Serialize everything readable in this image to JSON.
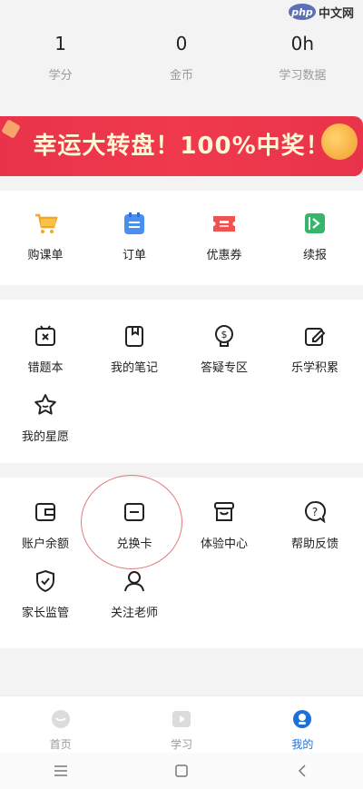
{
  "watermark": {
    "logo": "php",
    "text": "中文网"
  },
  "stats": [
    {
      "value": "1",
      "label": "学分"
    },
    {
      "value": "0",
      "label": "金币"
    },
    {
      "value": "0h",
      "label": "学习数据"
    }
  ],
  "banner": {
    "text": "幸运大转盘！100%中奖！"
  },
  "section1": [
    {
      "label": "购课单",
      "icon": "shopping-cart-icon"
    },
    {
      "label": "订单",
      "icon": "order-icon"
    },
    {
      "label": "优惠券",
      "icon": "coupon-icon"
    },
    {
      "label": "续报",
      "icon": "renew-icon"
    }
  ],
  "section2": [
    {
      "label": "错题本",
      "icon": "wrong-book-icon"
    },
    {
      "label": "我的笔记",
      "icon": "notes-icon"
    },
    {
      "label": "答疑专区",
      "icon": "qa-icon"
    },
    {
      "label": "乐学积累",
      "icon": "accumulate-icon"
    },
    {
      "label": "我的星愿",
      "icon": "star-wish-icon"
    }
  ],
  "section3": [
    {
      "label": "账户余额",
      "icon": "wallet-icon"
    },
    {
      "label": "兑换卡",
      "icon": "card-icon"
    },
    {
      "label": "体验中心",
      "icon": "experience-icon"
    },
    {
      "label": "帮助反馈",
      "icon": "help-icon"
    },
    {
      "label": "家长监管",
      "icon": "shield-icon"
    },
    {
      "label": "关注老师",
      "icon": "person-icon"
    }
  ],
  "tabs": [
    {
      "label": "首页",
      "icon": "home-icon"
    },
    {
      "label": "学习",
      "icon": "play-icon"
    },
    {
      "label": "我的",
      "icon": "profile-icon"
    }
  ],
  "colors": {
    "accent": "#1f6fd9",
    "banner": "#e8334a"
  }
}
